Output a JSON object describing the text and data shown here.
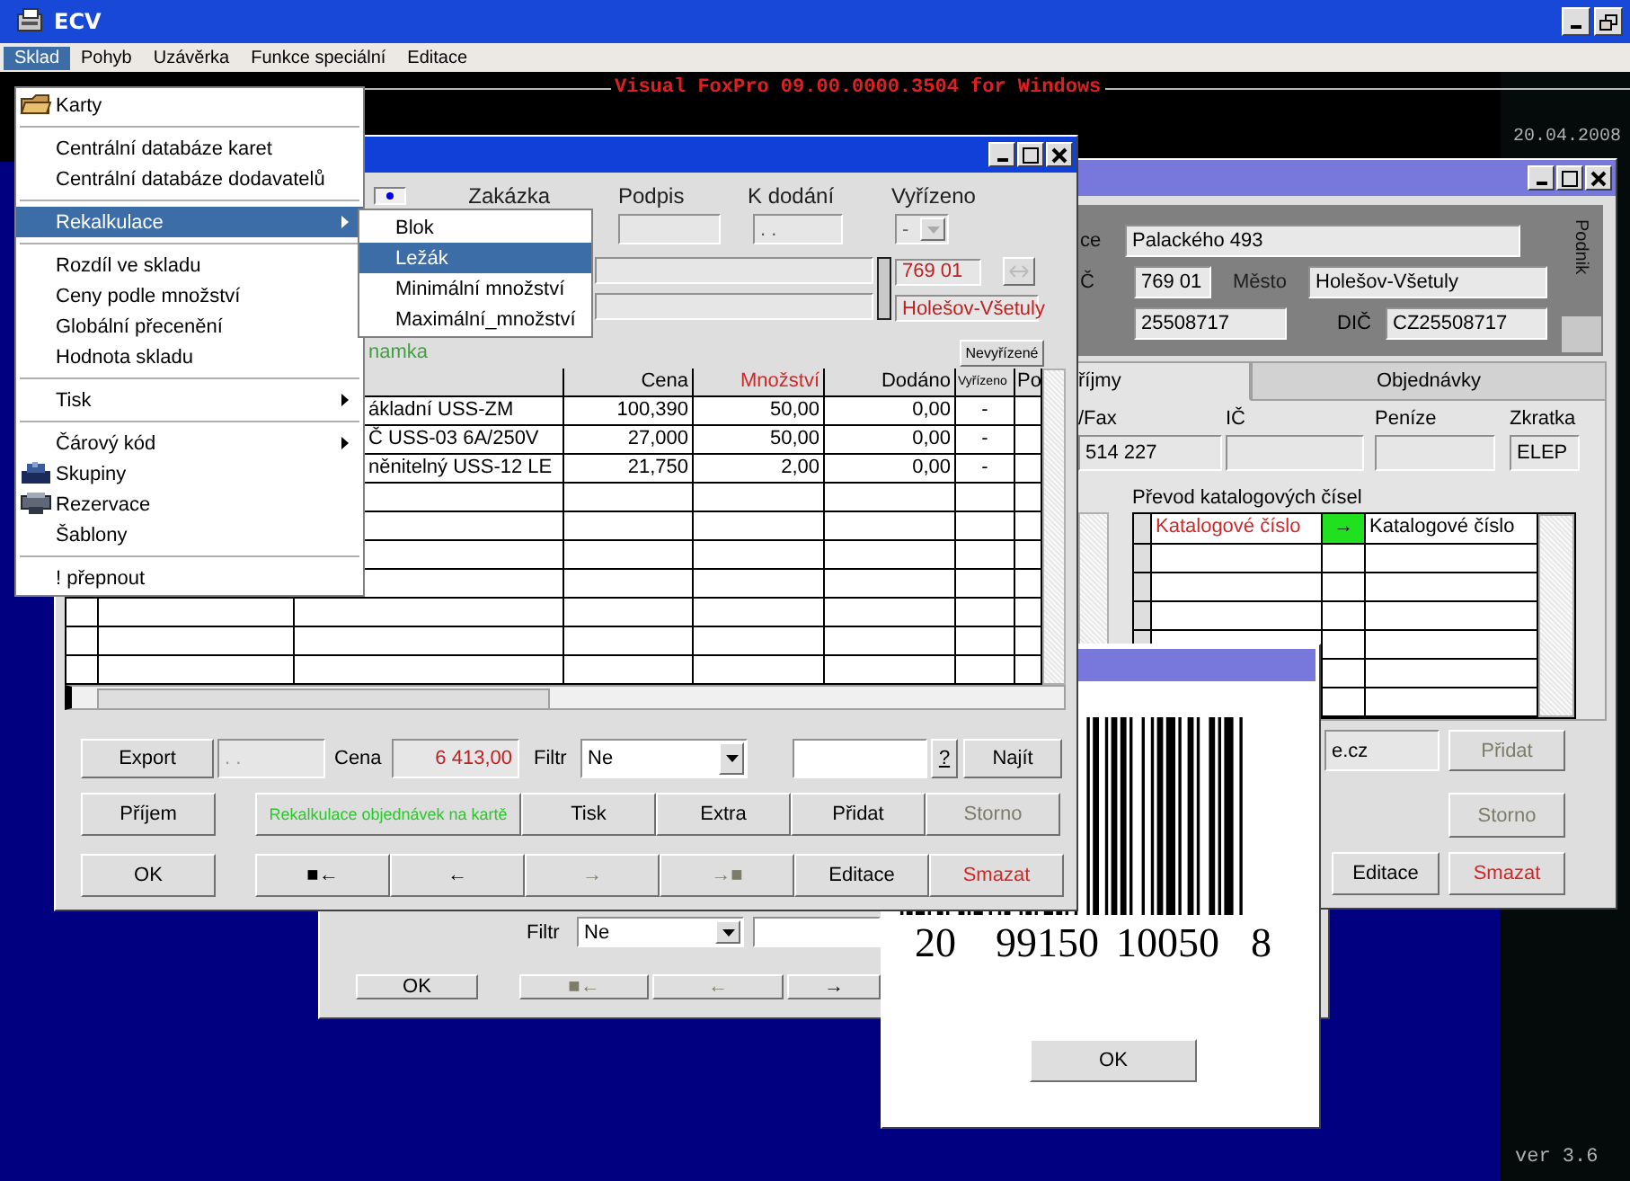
{
  "app": {
    "title": "ECV",
    "menubar": [
      {
        "label": "Sklad",
        "selected": true
      },
      {
        "label": "Pohyb",
        "selected": false
      },
      {
        "label": "Uzávěrka",
        "selected": false
      },
      {
        "label": "Funkce speciální",
        "selected": false
      },
      {
        "label": "Editace",
        "selected": false
      }
    ]
  },
  "console": {
    "banner": "Visual FoxPro 09.00.0000.3504 for Windows",
    "date": "20.04.2008",
    "version": "ver 3.6"
  },
  "back_window": {
    "filter_label": "Filtr",
    "filter": "Ne",
    "buttons": [
      {
        "label": "OK",
        "disabled": false
      },
      {
        "label": "■←",
        "disabled": true
      },
      {
        "label": "←",
        "disabled": true
      },
      {
        "label": "→",
        "disabled": false
      }
    ]
  },
  "firm_window": {
    "active": false,
    "address": {
      "street_label": "ce",
      "street": "Palackého 493",
      "zip_label": "Č",
      "zip": "769 01",
      "city_label": "Město",
      "city": "Holešov-Všetuly",
      "id": "25508717",
      "vat_label": "DIČ",
      "vat": "CZ25508717",
      "side_tab": "Podnik"
    },
    "tabs": [
      {
        "label": "říjmy",
        "selected": true
      },
      {
        "label": "Objednávky",
        "selected": false
      }
    ],
    "fields": [
      {
        "label": "/Fax",
        "value": "514 227"
      },
      {
        "label": "IČ"
      },
      {
        "label": "Peníze"
      },
      {
        "label": "Zkratka",
        "value": "ELEP"
      }
    ],
    "conversion": {
      "title": "Převod katalogových čísel",
      "columns": [
        {
          "label": "Katalogové číslo",
          "kind": "text",
          "emphasis": true
        },
        {
          "label": "→",
          "kind": "arrow",
          "emphasis": false
        },
        {
          "label": "Katalogové číslo",
          "kind": "text",
          "emphasis": false
        }
      ]
    },
    "web": "e.cz",
    "buttons": [
      {
        "label": "Přidat",
        "disabled": true
      },
      {
        "label": "Storno",
        "disabled": true
      },
      {
        "label": "Editace",
        "disabled": false
      },
      {
        "label": "Smazat",
        "disabled": false,
        "color": "#d02828"
      }
    ]
  },
  "barcode_dialog": {
    "active": false,
    "digits": [
      "20",
      "99150",
      "10050",
      "8"
    ],
    "ok": "OK"
  },
  "order_window": {
    "active": true,
    "header": {
      "labels": [
        "Zakázka",
        "Podpis",
        "K dodání",
        "Vyřízeno"
      ],
      "delivery": ". .",
      "done": "-",
      "zip": "769 01",
      "city": "Holešov-Všetuly",
      "swap_disabled": true,
      "note_label": "namka",
      "pending_button": "Nevyřízené"
    },
    "table": {
      "columns": [
        {
          "label": "Cena",
          "emphasis": false
        },
        {
          "label": "Množství",
          "emphasis": true
        },
        {
          "label": "Dodáno",
          "emphasis": false
        },
        {
          "label": "Vyřízeno",
          "emphasis": false
        },
        {
          "label": "Po",
          "emphasis": false
        }
      ],
      "rows": [
        {
          "name": "ákladní USS-ZM",
          "price": "100,390",
          "quantity": "50,00",
          "delivered": "0,00",
          "done": "-"
        },
        {
          "name": "Č USS-03 6A/250V",
          "price": "27,000",
          "quantity": "50,00",
          "delivered": "0,00",
          "done": "-"
        },
        {
          "name": "něnitelný USS-12 LE",
          "price": "21,750",
          "quantity": "2,00",
          "delivered": "0,00",
          "done": "-"
        }
      ]
    },
    "footer": {
      "export": "Export",
      "export_field": ". .",
      "price_label": "Cena",
      "price": "6 413,00",
      "filter_label": "Filtr",
      "filter": "Ne",
      "help": "?",
      "find": "Najít",
      "button_rows": [
        [
          {
            "label": "Příjem",
            "disabled": false
          },
          {
            "label": "Rekalkulace objednávek na kartě",
            "disabled": false,
            "color": "#28c828"
          },
          {
            "label": "Tisk",
            "disabled": false
          },
          {
            "label": "Extra",
            "disabled": false
          },
          {
            "label": "Přidat",
            "disabled": false
          },
          {
            "label": "Storno",
            "disabled": true
          }
        ],
        [
          {
            "label": "OK",
            "disabled": false
          },
          {
            "label": "■←",
            "disabled": false
          },
          {
            "label": "←",
            "disabled": false
          },
          {
            "label": "→",
            "disabled": true
          },
          {
            "label": "→■",
            "disabled": true
          },
          {
            "label": "Editace",
            "disabled": false
          },
          {
            "label": "Smazat",
            "disabled": false,
            "color": "#d02828"
          }
        ]
      ]
    }
  },
  "menu": {
    "items": [
      {
        "kind": "item",
        "label": "Karty",
        "icon": true,
        "submenu": false,
        "selected": false
      },
      {
        "kind": "separator"
      },
      {
        "kind": "item",
        "label": "Centrální databáze karet",
        "icon": false,
        "submenu": false,
        "selected": false
      },
      {
        "kind": "item",
        "label": "Centrální databáze dodavatelů",
        "icon": false,
        "submenu": false,
        "selected": false
      },
      {
        "kind": "separator"
      },
      {
        "kind": "item",
        "label": "Rekalkulace",
        "icon": false,
        "submenu": true,
        "selected": true
      },
      {
        "kind": "separator"
      },
      {
        "kind": "item",
        "label": "Rozdíl ve skladu",
        "icon": false,
        "submenu": false,
        "selected": false
      },
      {
        "kind": "item",
        "label": "Ceny podle množství",
        "icon": false,
        "submenu": false,
        "selected": false
      },
      {
        "kind": "item",
        "label": "Globální přecenění",
        "icon": false,
        "submenu": false,
        "selected": false
      },
      {
        "kind": "item",
        "label": "Hodnota skladu",
        "icon": false,
        "submenu": false,
        "selected": false
      },
      {
        "kind": "separator"
      },
      {
        "kind": "item",
        "label": "Tisk",
        "icon": false,
        "submenu": true,
        "selected": false
      },
      {
        "kind": "separator"
      },
      {
        "kind": "item",
        "label": "Čárový kód",
        "icon": false,
        "submenu": true,
        "selected": false
      },
      {
        "kind": "item",
        "label": "Skupiny",
        "icon": true,
        "submenu": false,
        "selected": false
      },
      {
        "kind": "item",
        "label": "Rezervace",
        "icon": true,
        "submenu": false,
        "selected": false
      },
      {
        "kind": "item",
        "label": "Šablony",
        "icon": false,
        "submenu": false,
        "selected": false
      },
      {
        "kind": "separator"
      },
      {
        "kind": "item",
        "label": "! přepnout",
        "icon": false,
        "submenu": false,
        "selected": false
      }
    ]
  },
  "submenu": {
    "items": [
      {
        "label": "Blok",
        "selected": false
      },
      {
        "label": "Ležák",
        "selected": true
      },
      {
        "label": "Minimální množství",
        "selected": false
      },
      {
        "label": "Maximální_množství",
        "selected": false
      }
    ]
  }
}
